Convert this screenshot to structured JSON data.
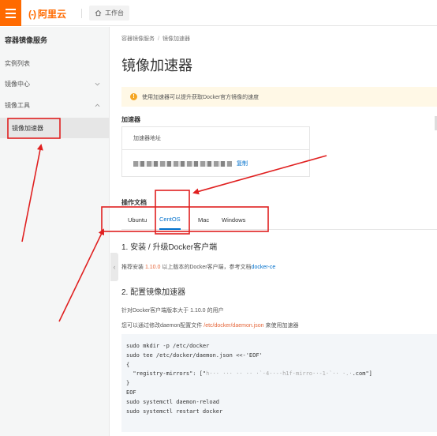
{
  "topbar": {
    "brand": "阿里云",
    "brand_mark": "(-)",
    "workbench_label": "工作台"
  },
  "sidebar": {
    "title": "容器镜像服务",
    "items": [
      {
        "label": "实例列表",
        "chevron": ""
      },
      {
        "label": "镜像中心",
        "chevron": "chevron-down"
      },
      {
        "label": "镜像工具",
        "chevron": "chevron-up"
      }
    ],
    "sub_item": "镜像加速器",
    "collapse_glyph": "‹"
  },
  "main": {
    "breadcrumb": [
      "容器镜像服务",
      "镜像加速器"
    ],
    "breadcrumb_sep": "/",
    "title": "镜像加速器",
    "notice": "使用加速器可以提升获取Docker官方镜像的速度",
    "notice_icon": "!",
    "accelerator_label": "加速器",
    "accelerator_table_header": "加速器地址",
    "copy_label": "复制",
    "ops_label": "操作文档",
    "tabs": [
      "Ubuntu",
      "CentOS",
      "Mac",
      "Windows"
    ],
    "active_tab": "CentOS",
    "section1_title": "1. 安装 / 升级Docker客户端",
    "section1_text_a": "推荐安装 ",
    "section1_version": "1.10.0",
    "section1_text_b": " 以上版本的Docker客户端，参考文档",
    "section1_link": "docker-ce",
    "section2_title": "2. 配置镜像加速器",
    "section2_text1": "针对Docker客户端版本大于 1.10.0 的用户",
    "section2_text2_a": "您可以通过修改daemon配置文件 ",
    "section2_text2_path": "/etc/docker/daemon.json",
    "section2_text2_b": " 来使用加速器",
    "code_lines": [
      "sudo mkdir -p /etc/docker",
      "sudo tee /etc/docker/daemon.json <<-'EOF'",
      "{",
      "  \"registry-mirrors\": [\"",
      "}",
      "EOF",
      "sudo systemctl daemon-reload",
      "sudo systemctl restart docker"
    ],
    "code_blur": "h··· ··· ·· ·· ·`·4··-·h1f·mirro··-1·`·· ·.·",
    "code_tail": ".com\"]"
  },
  "colors": {
    "brand_orange": "#ff6a00",
    "link_blue": "#0070cc",
    "annotation_red": "#e02020",
    "notice_bg": "#fff8e6"
  }
}
